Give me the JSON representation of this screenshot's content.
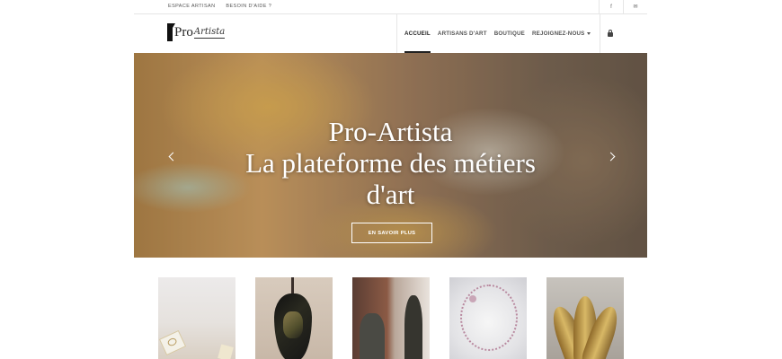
{
  "topbar": {
    "links": [
      "ESPACE ARTISAN",
      "BESOIN D'AIDE ?"
    ],
    "social": [
      "f",
      "✉"
    ]
  },
  "header": {
    "logo_pro": "Pro",
    "logo_artista": "Artista",
    "nav": [
      {
        "label": "ACCUEIL",
        "active": true
      },
      {
        "label": "ARTISANS D'ART",
        "active": false
      },
      {
        "label": "BOUTIQUE",
        "active": false
      },
      {
        "label": "REJOIGNEZ-NOUS",
        "active": false
      }
    ],
    "cart_icon": "shopping-bag-icon"
  },
  "hero": {
    "title_lines": [
      "Pro-Artista",
      "La plateforme des métiers",
      "d'art"
    ],
    "cta_label": "EN SAVOIR PLUS"
  },
  "products": [
    {
      "name": "ceramic-tags"
    },
    {
      "name": "black-pendant"
    },
    {
      "name": "sculpture-figures"
    },
    {
      "name": "pink-necklace"
    },
    {
      "name": "gold-flower-lamp"
    }
  ]
}
